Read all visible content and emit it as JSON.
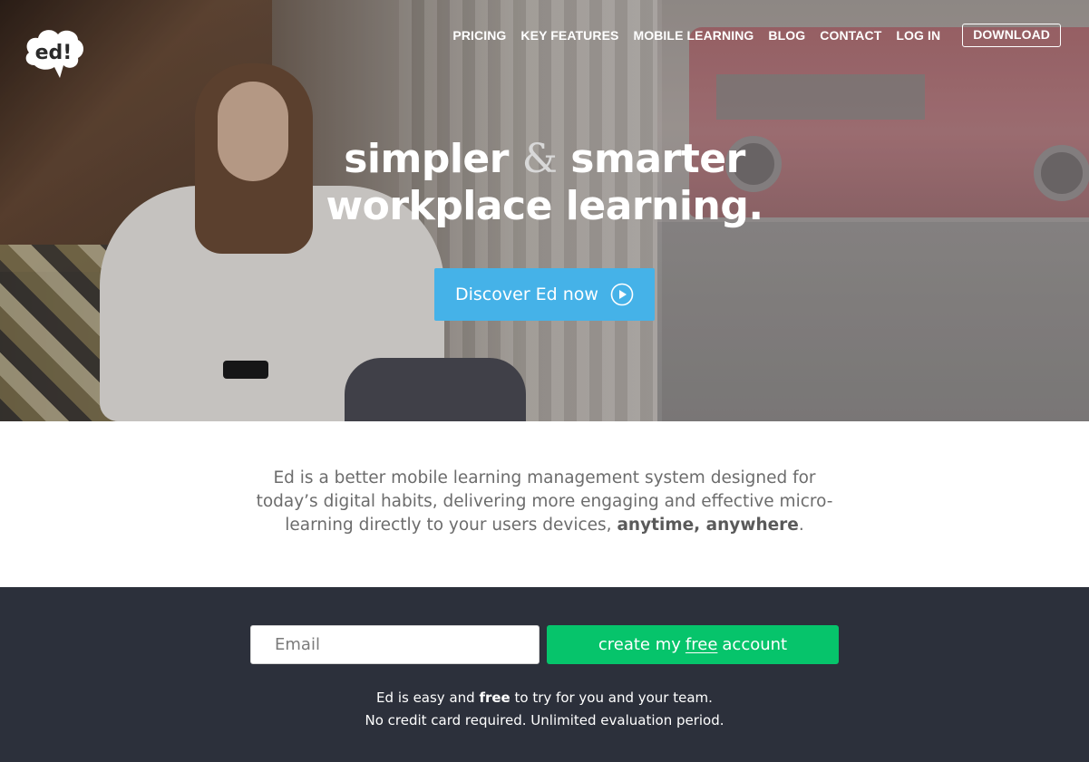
{
  "nav": {
    "items": [
      "PRICING",
      "KEY FEATURES",
      "MOBILE LEARNING",
      "BLOG",
      "CONTACT",
      "LOG IN"
    ],
    "download": "DOWNLOAD"
  },
  "logo": {
    "text": "ed!"
  },
  "hero": {
    "line1_a": "simpler",
    "amp": "&",
    "line1_b": "smarter",
    "line2": "workplace learning.",
    "cta_label": "Discover Ed now"
  },
  "description": {
    "text": "Ed is a better mobile learning management system designed for today’s digital habits, delivering more engaging and effective micro-learning directly to your users devices,",
    "emphasis": "anytime, anywhere",
    "end": "."
  },
  "signup": {
    "email_placeholder": "Email",
    "button_pre": "create my",
    "button_free": "free",
    "button_post": "account",
    "note_line1_pre": "Ed is easy and",
    "note_line1_bold": "free",
    "note_line1_post": "to try for you and your team.",
    "note_line2": "No credit card required. Unlimited evaluation period."
  },
  "colors": {
    "cta_blue": "#45b2e8",
    "signup_bg": "#2c303b",
    "create_green": "#06c46b"
  },
  "icons": [
    "ed-logo-icon",
    "play-circle-icon"
  ]
}
